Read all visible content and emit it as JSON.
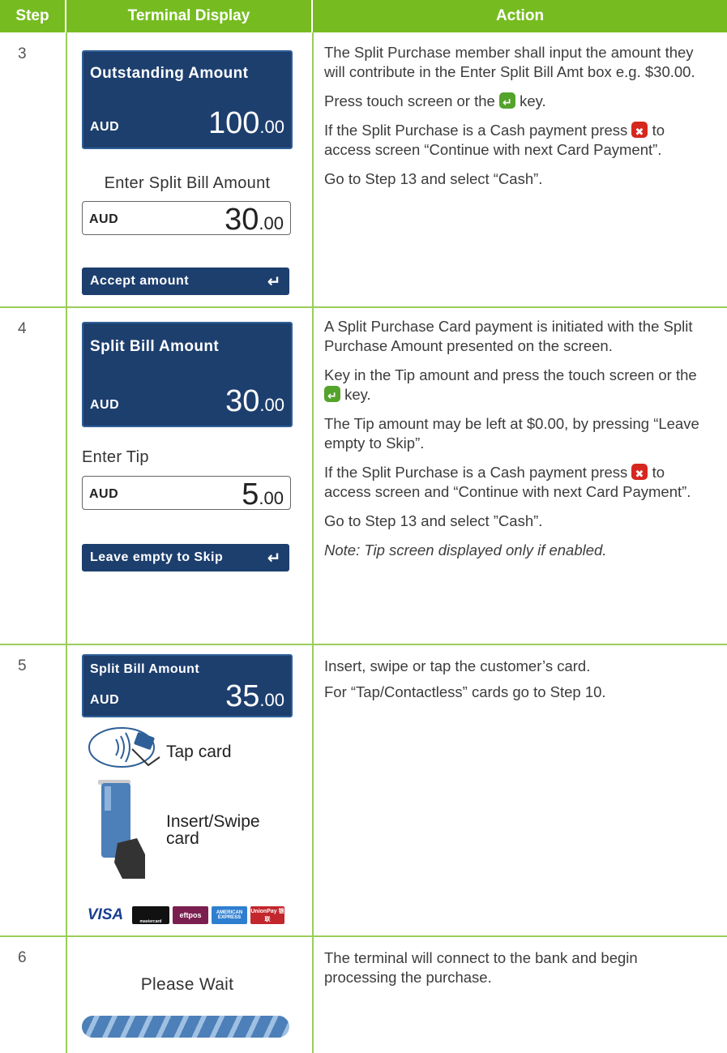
{
  "headers": {
    "step": "Step",
    "terminal": "Terminal Display",
    "action": "Action"
  },
  "rows": [
    {
      "step": "3",
      "screen": {
        "title": "Outstanding Amount",
        "currency": "AUD",
        "amount_int": "100",
        "amount_dec": ".00"
      },
      "label": "Enter Split Bill Amount",
      "input": {
        "currency": "AUD",
        "amount_int": "30",
        "amount_dec": ".00"
      },
      "button": "Accept amount",
      "actions": [
        "The Split Purchase member shall input the amount they will contribute in the Enter Split Bill Amt box e.g. $30.00.",
        "Press touch screen or the",
        "key.",
        "If the Split Purchase is a Cash payment press",
        "to access screen “Continue with next Card Payment”.",
        "Go to Step 13 and select “Cash”."
      ]
    },
    {
      "step": "4",
      "screen": {
        "title": "Split Bill Amount",
        "currency": "AUD",
        "amount_int": "30",
        "amount_dec": ".00"
      },
      "label": "Enter Tip",
      "input": {
        "currency": "AUD",
        "amount_int": "5",
        "amount_dec": ".00"
      },
      "button": "Leave empty to Skip",
      "actions": [
        "A Split Purchase Card payment is initiated with the Split Purchase Amount presented on the screen.",
        "Key in the Tip amount and press the touch screen or the",
        "key.",
        "The Tip amount may be left at $0.00, by pressing “Leave empty to Skip”.",
        "If the Split Purchase is a Cash payment press",
        "to access screen and “Continue with next Card Payment”.",
        "Go to Step 13 and select ”Cash”.",
        "Note: Tip screen displayed only if enabled."
      ]
    },
    {
      "step": "5",
      "screen": {
        "title": "Split Bill Amount",
        "currency": "AUD",
        "amount_int": "35",
        "amount_dec": ".00"
      },
      "tap_label": "Tap card",
      "insert_label_1": "Insert/Swipe",
      "insert_label_2": "card",
      "logos": [
        "VISA",
        "mastercard",
        "eftpos",
        "AMERICAN EXPRESS",
        "UnionPay 银联"
      ],
      "actions": [
        "Insert, swipe or tap the customer’s card.",
        "For “Tap/Contactless” cards go to Step 10."
      ]
    },
    {
      "step": "6",
      "wait": "Please Wait",
      "actions": [
        "The terminal will connect to the bank and begin processing the purchase."
      ]
    }
  ],
  "colors": {
    "header": "#76bc21",
    "screen": "#1d3f6e",
    "enter_key": "#54a32a",
    "cancel_key": "#d6271f"
  }
}
